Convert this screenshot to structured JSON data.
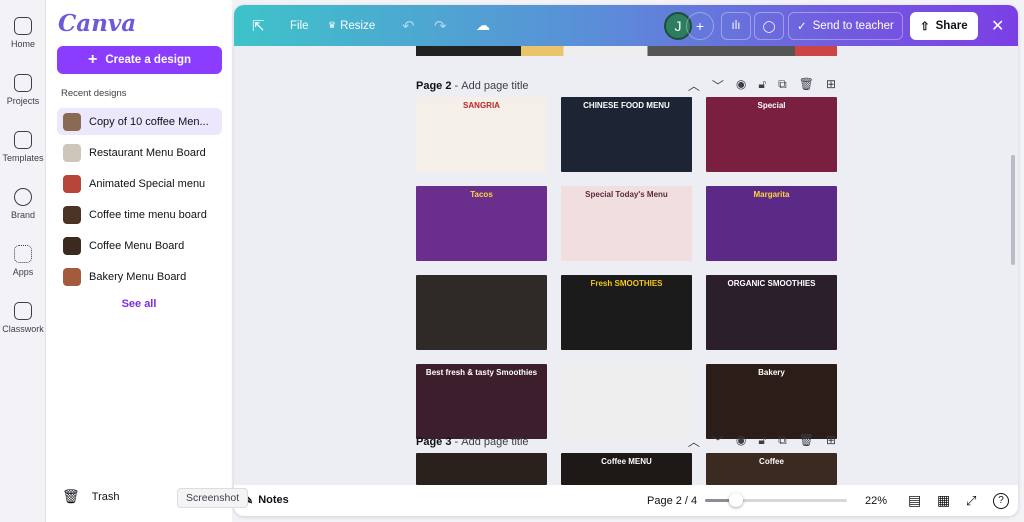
{
  "rail": [
    {
      "label": "Home",
      "icon": "home-icon"
    },
    {
      "label": "Projects",
      "icon": "folder-icon"
    },
    {
      "label": "Templates",
      "icon": "templates-icon"
    },
    {
      "label": "Brand",
      "icon": "brand-icon"
    },
    {
      "label": "Apps",
      "icon": "apps-icon"
    },
    {
      "label": "Classwork",
      "icon": "classwork-icon"
    }
  ],
  "panel": {
    "logo": "Canva",
    "create": "Create a design",
    "recent_heading": "Recent designs",
    "recent": [
      {
        "label": "Copy of 10 coffee Men...",
        "color": "#8a6a52"
      },
      {
        "label": "Restaurant Menu Board",
        "color": "#cfc6bb"
      },
      {
        "label": "Animated Special menu",
        "color": "#b6463a"
      },
      {
        "label": "Coffee time menu board",
        "color": "#4b3325"
      },
      {
        "label": "Coffee Menu Board",
        "color": "#3a2a20"
      },
      {
        "label": "Bakery Menu Board",
        "color": "#a45a3c"
      }
    ],
    "see_all": "See all",
    "trash": "Trash"
  },
  "topbar": {
    "file": "File",
    "resize": "Resize",
    "avatar": "J",
    "send": "Send to teacher",
    "share": "Share"
  },
  "pages": [
    {
      "label": "Page 2",
      "title_placeholder": "Add page title"
    },
    {
      "label": "Page 3",
      "title_placeholder": "Add page title"
    }
  ],
  "page2_tiles": [
    {
      "text": "SANGRIA",
      "bg": "#f4efe9",
      "fg": "#c0262b"
    },
    {
      "text": "CHINESE FOOD MENU",
      "bg": "#1d2433",
      "fg": "#fff"
    },
    {
      "text": "Special",
      "bg": "#7a1f3f",
      "fg": "#fff"
    },
    {
      "text": "Tacos",
      "bg": "#6a2f8c",
      "fg": "#ffd23f"
    },
    {
      "text": "Special Today's Menu",
      "bg": "#f1dfe0",
      "fg": "#5a2b3c"
    },
    {
      "text": "Margarita",
      "bg": "#5b2a86",
      "fg": "#ffd23f"
    },
    {
      "text": "",
      "bg": "#2f2a27",
      "fg": "#fff"
    },
    {
      "text": "Fresh SMOOTHIES",
      "bg": "#1b1b1b",
      "fg": "#f5c518"
    },
    {
      "text": "ORGANIC SMOOTHIES",
      "bg": "#2a1f2b",
      "fg": "#fff"
    },
    {
      "text": "Best fresh & tasty Smoothies",
      "bg": "#3c1e2d",
      "fg": "#fff"
    },
    {
      "text": "",
      "bg": "#eeeeee",
      "fg": "#222"
    },
    {
      "text": "Bakery",
      "bg": "#2b1d17",
      "fg": "#fff"
    }
  ],
  "page3_tiles": [
    {
      "text": "",
      "bg": "#2a211c",
      "fg": "#fff"
    },
    {
      "text": "Coffee MENU",
      "bg": "#1e1916",
      "fg": "#fff"
    },
    {
      "text": "Coffee",
      "bg": "#3b2a20",
      "fg": "#fff"
    }
  ],
  "bottom": {
    "notes": "Notes",
    "tooltip": "Screenshot",
    "page_indicator": "Page 2 / 4",
    "zoom": "22%",
    "zoom_slider_fraction": 0.22
  }
}
